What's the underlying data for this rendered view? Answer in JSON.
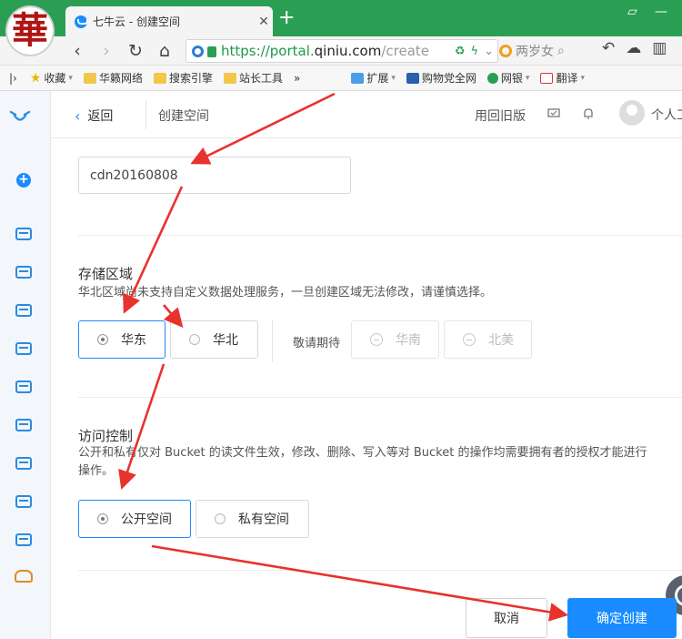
{
  "browser": {
    "logo_char": "華",
    "tab_title": "七牛云 - 创建空间",
    "tab_close": "✕",
    "new_tab": "+",
    "url_scheme": "https://",
    "url_host_prefix": "portal.",
    "url_host_main": "qiniu.com",
    "url_path": "/create",
    "search_text": "两岁女",
    "bookmarks": [
      {
        "label": "收藏",
        "dropdown": true
      },
      {
        "label": "华籁网络",
        "dropdown": false
      },
      {
        "label": "搜索引擎",
        "dropdown": false
      },
      {
        "label": "站长工具",
        "dropdown": false
      },
      {
        "label": "扩展",
        "dropdown": true
      },
      {
        "label": "购物党全网",
        "dropdown": false
      },
      {
        "label": "网银",
        "dropdown": true
      },
      {
        "label": "翻译",
        "dropdown": true
      }
    ],
    "bookmarks_more": "»"
  },
  "header": {
    "back_label": "返回",
    "title": "创建空间",
    "old_version": "用回旧版",
    "user": "个人工"
  },
  "form": {
    "bucket_name_value": "cdn20160808",
    "region": {
      "title": "存储区域",
      "desc": "华北区域尚未支持自定义数据处理服务，一旦创建区域无法修改，请谨慎选择。",
      "options": [
        {
          "label": "华东",
          "selected": true
        },
        {
          "label": "华北",
          "selected": false
        }
      ],
      "coming_soon_label": "敬请期待",
      "disabled_options": [
        {
          "label": "华南"
        },
        {
          "label": "北美"
        }
      ]
    },
    "access": {
      "title": "访问控制",
      "desc_line1": "公开和私有仅对 Bucket 的读文件生效，修改、删除、写入等对 Bucket 的操作均需要拥有者的授权才能进行",
      "desc_line2": "操作。",
      "options": [
        {
          "label": "公开空间",
          "selected": true
        },
        {
          "label": "私有空间",
          "selected": false
        }
      ]
    },
    "cancel_label": "取消",
    "confirm_label": "确定创建"
  },
  "colors": {
    "accent": "#1a8cff",
    "annotation_arrow": "#e8322e",
    "browser_green": "#2a9f54"
  }
}
